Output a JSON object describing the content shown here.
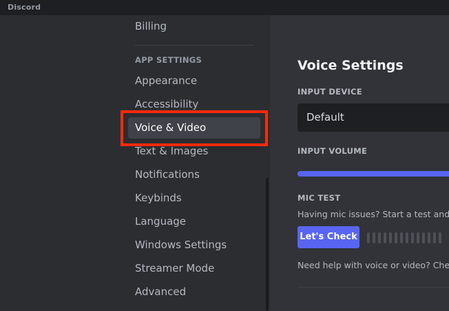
{
  "app": {
    "name": "Discord"
  },
  "sidebar": {
    "items": [
      {
        "label": "Billing"
      },
      {
        "label": "Appearance"
      },
      {
        "label": "Accessibility"
      },
      {
        "label": "Voice & Video",
        "selected": true
      },
      {
        "label": "Text & Images"
      },
      {
        "label": "Notifications"
      },
      {
        "label": "Keybinds"
      },
      {
        "label": "Language"
      },
      {
        "label": "Windows Settings"
      },
      {
        "label": "Streamer Mode"
      },
      {
        "label": "Advanced"
      }
    ],
    "app_settings_header": "APP SETTINGS"
  },
  "main": {
    "title": "Voice Settings",
    "input_device": {
      "label": "INPUT DEVICE",
      "value": "Default"
    },
    "input_volume": {
      "label": "INPUT VOLUME",
      "level_fraction": 1.0
    },
    "mic_test": {
      "label": "MIC TEST",
      "description": "Having mic issues? Start a test and sa",
      "button_label": "Let's Check"
    },
    "help_text": "Need help with voice or video? Check"
  },
  "colors": {
    "accent": "#5865f2",
    "highlight_box": "#ff2a0a",
    "sidebar_bg": "#2b2d31",
    "content_bg": "#313338",
    "titlebar_bg": "#1e1f22"
  }
}
